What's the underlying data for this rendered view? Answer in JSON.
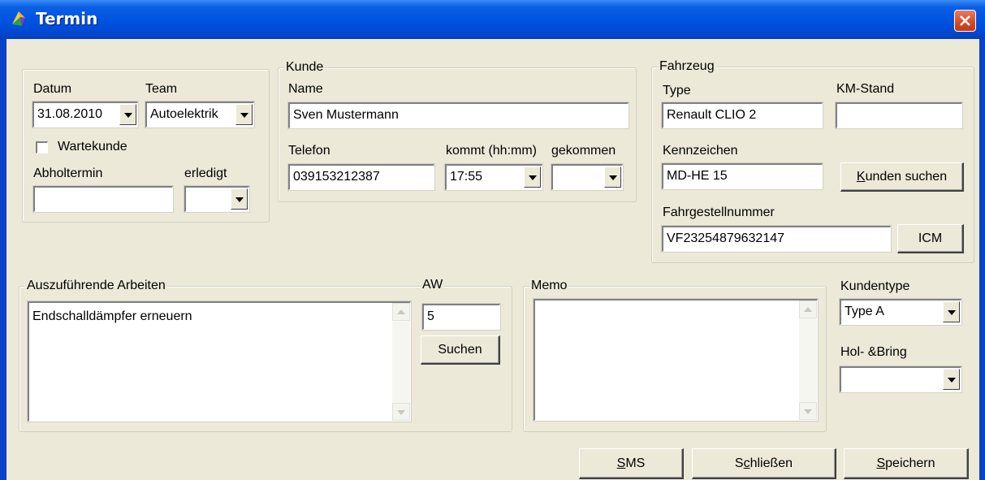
{
  "window": {
    "title": "Termin"
  },
  "left_group": {
    "datum_label": "Datum",
    "datum_value": "31.08.2010",
    "team_label": "Team",
    "team_value": "Autoelektrik",
    "wartekunde_label": "Wartekunde",
    "wartekunde_checked": false,
    "abholtermin_label": "Abholtermin",
    "abholtermin_value": "",
    "erledigt_label": "erledigt",
    "erledigt_value": ""
  },
  "kunde": {
    "legend": "Kunde",
    "name_label": "Name",
    "name_value": "Sven Mustermann",
    "telefon_label": "Telefon",
    "telefon_value": "039153212387",
    "kommt_label": "kommt (hh:mm)",
    "kommt_value": "17:55",
    "gekommen_label": "gekommen",
    "gekommen_value": ""
  },
  "fahrzeug": {
    "legend": "Fahrzeug",
    "type_label": "Type",
    "type_value": "Renault CLIO 2",
    "km_label": "KM-Stand",
    "km_value": "",
    "kennzeichen_label": "Kennzeichen",
    "kennzeichen_value": "MD-HE 15",
    "kunden_suchen_prefix": "K",
    "kunden_suchen_rest": "unden suchen",
    "fahrgestell_label": "Fahrgestellnummer",
    "fahrgestell_value": "VF23254879632147",
    "icm_label": "ICM"
  },
  "arbeiten": {
    "legend": "Auszuführende Arbeiten",
    "text": "Endschalldämpfer erneuern",
    "aw_label": "AW",
    "aw_value": "5",
    "suchen_label": "Suchen"
  },
  "memo": {
    "legend": "Memo",
    "text": ""
  },
  "right_panel": {
    "kundentype_label": "Kundentype",
    "kundentype_value": "Type A",
    "holbring_label": "Hol- &Bring",
    "holbring_value": ""
  },
  "footer": {
    "sms_prefix": "S",
    "sms_rest": "MS",
    "schliessen_prefix": "S",
    "schliessen_mid": "c",
    "schliessen_rest": "hließen",
    "speichern_prefix": "S",
    "speichern_rest": "peichern"
  },
  "colors": {
    "titlebar": "#0054e3",
    "dialog_bg": "#ece9d8",
    "close": "#d34a27"
  },
  "icons": {
    "app": "app-icon",
    "close": "close-icon",
    "dropdown": "chevron-down-icon"
  }
}
